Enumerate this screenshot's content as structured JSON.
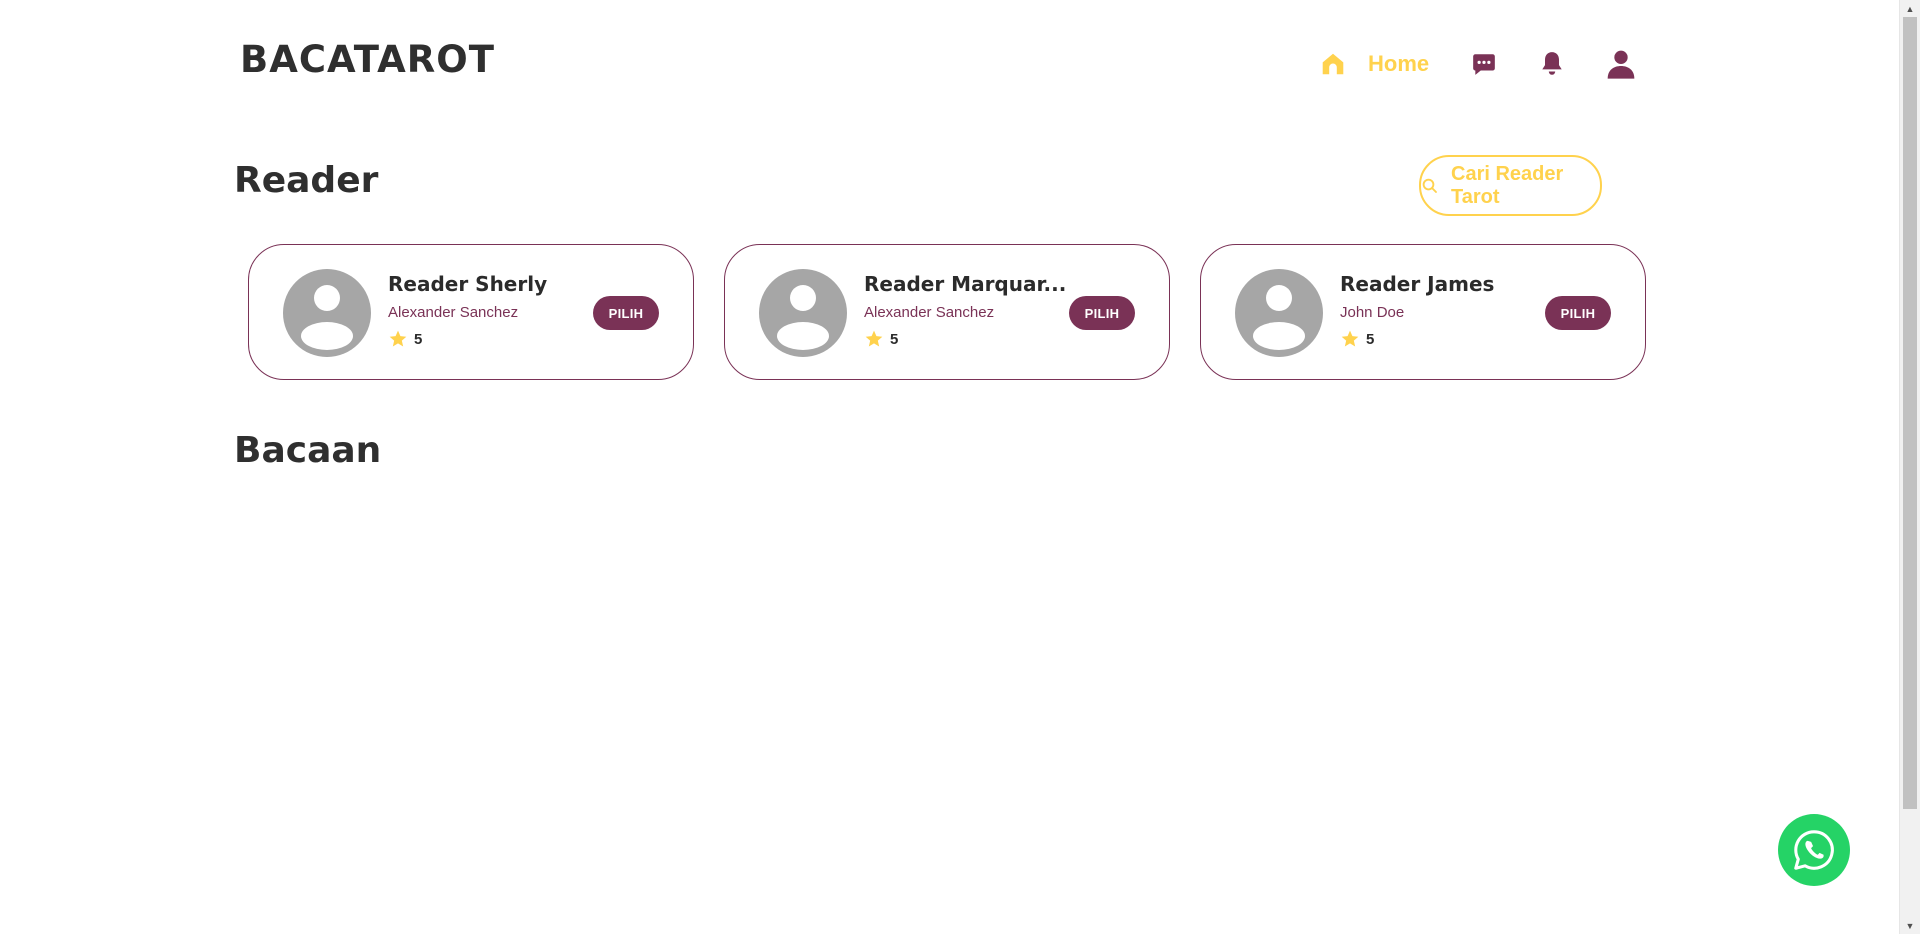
{
  "header": {
    "brand": "BACATAROT",
    "nav": {
      "home_label": "Home",
      "home_icon": "home-icon",
      "chat_icon": "chat-icon",
      "bell_icon": "bell-icon",
      "user_icon": "user-icon"
    }
  },
  "reader_section": {
    "title": "Reader",
    "search_label": "Cari Reader Tarot",
    "cards": [
      {
        "name": "Reader Sherly",
        "subtitle": "Alexander Sanchez",
        "rating": "5",
        "button": "PILIH"
      },
      {
        "name": "Reader Marquar...",
        "subtitle": "Alexander Sanchez",
        "rating": "5",
        "button": "PILIH"
      },
      {
        "name": "Reader James",
        "subtitle": "John Doe",
        "rating": "5",
        "button": "PILIH"
      }
    ]
  },
  "bacaan_section": {
    "title": "Bacaan"
  },
  "colors": {
    "primary": "#7a3256",
    "accent": "#ffd24d",
    "whatsapp": "#25d366"
  }
}
